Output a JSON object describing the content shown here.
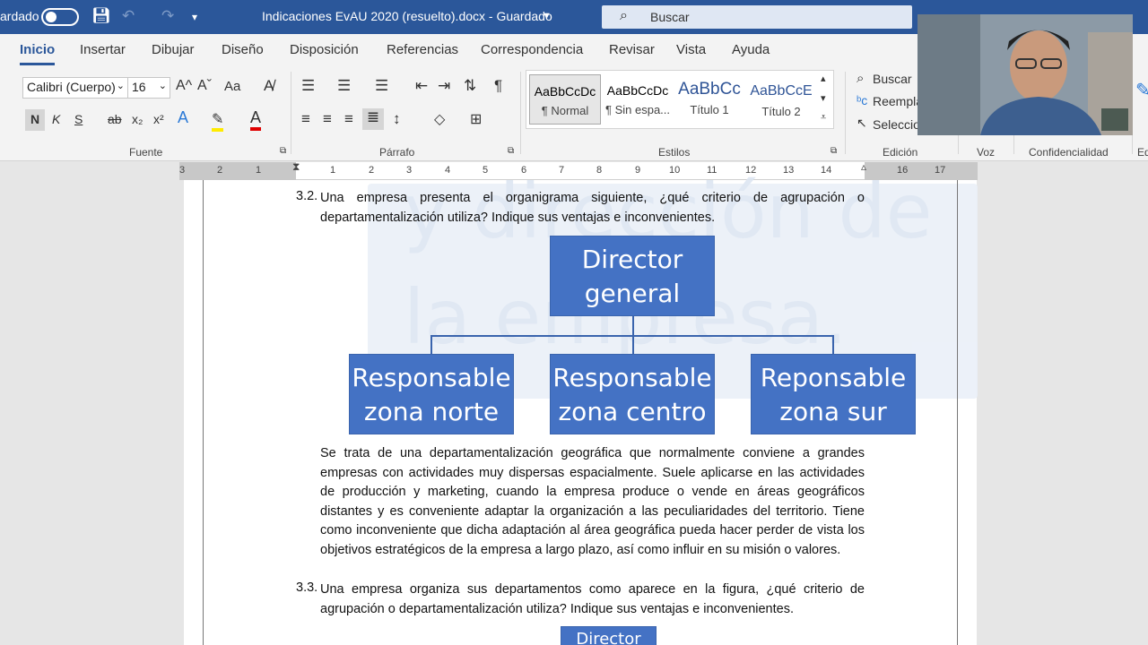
{
  "titlebar": {
    "autosave_label": "ardado",
    "document_title": "Indicaciones EvAU 2020 (resuelto).docx - Guardado",
    "search_placeholder": "Buscar"
  },
  "tabs": [
    "Inicio",
    "Insertar",
    "Dibujar",
    "Diseño",
    "Disposición",
    "Referencias",
    "Correspondencia",
    "Revisar",
    "Vista",
    "Ayuda"
  ],
  "ribbon": {
    "font_name": "Calibri (Cuerpo)",
    "font_size": "16",
    "bold": "N",
    "italic": "K",
    "underline": "S",
    "strike": "ab",
    "subscript": "x₂",
    "superscript": "x²",
    "grow_font": "A^",
    "shrink_font": "Aˇ",
    "change_case": "Aa",
    "pilcrow": "¶",
    "groups": {
      "fuente": "Fuente",
      "parrafo": "Párrafo",
      "estilos": "Estilos",
      "edicion": "Edición",
      "voz": "Voz",
      "confidencialidad": "Confidencialidad",
      "ed_cut": "Ed"
    },
    "styles": [
      {
        "sample": "AaBbCcDc",
        "name": "¶ Normal"
      },
      {
        "sample": "AaBbCcDc",
        "name": "¶ Sin espa..."
      },
      {
        "sample": "AaBbCc",
        "name": "Título 1"
      },
      {
        "sample": "AaBbCcE",
        "name": "Título 2"
      }
    ],
    "edit": {
      "find": "Buscar",
      "replace": "Reempla",
      "select": "Seleccio"
    }
  },
  "ruler": {
    "left_numbers": [
      "3",
      "2",
      "1"
    ],
    "numbers": [
      "1",
      "2",
      "3",
      "4",
      "5",
      "6",
      "7",
      "8",
      "9",
      "10",
      "11",
      "12",
      "13",
      "14",
      "16",
      "17"
    ]
  },
  "document": {
    "q32_number": "3.2.",
    "q32_text": "Una empresa presenta el organigrama siguiente, ¿qué criterio de agrupación o departamentalización utiliza?  Indique sus ventajas e inconvenientes.",
    "org": {
      "top": [
        "Director",
        "general"
      ],
      "left": [
        "Responsable",
        "zona norte"
      ],
      "center": [
        "Responsable",
        "zona centro"
      ],
      "right": [
        "Reponsable",
        "zona sur"
      ]
    },
    "answer": "Se trata de una departamentalización geográfica que normalmente conviene a grandes empresas con actividades muy dispersas espacialmente.  Suele aplicarse en las actividades de producción y marketing, cuando la empresa produce o vende en áreas geográficos distantes y es conveniente adaptar la organización a las peculiaridades del territorio.  Tiene como inconveniente que dicha adaptación al área geográfica pueda hacer perder de vista los objetivos estratégicos de la empresa a largo plazo, así como influir en su misión o valores.",
    "q33_number": "3.3.",
    "q33_text": "Una empresa organiza sus departamentos como aparece en la figura, ¿qué criterio de agrupación o departamentalización utiliza?  Indique sus ventajas e inconvenientes.",
    "next_box": "Director",
    "watermark": [
      "y dirección de",
      "la empresa."
    ]
  },
  "colors": {
    "word_blue": "#2b579a",
    "org_box": "#4472c4"
  }
}
